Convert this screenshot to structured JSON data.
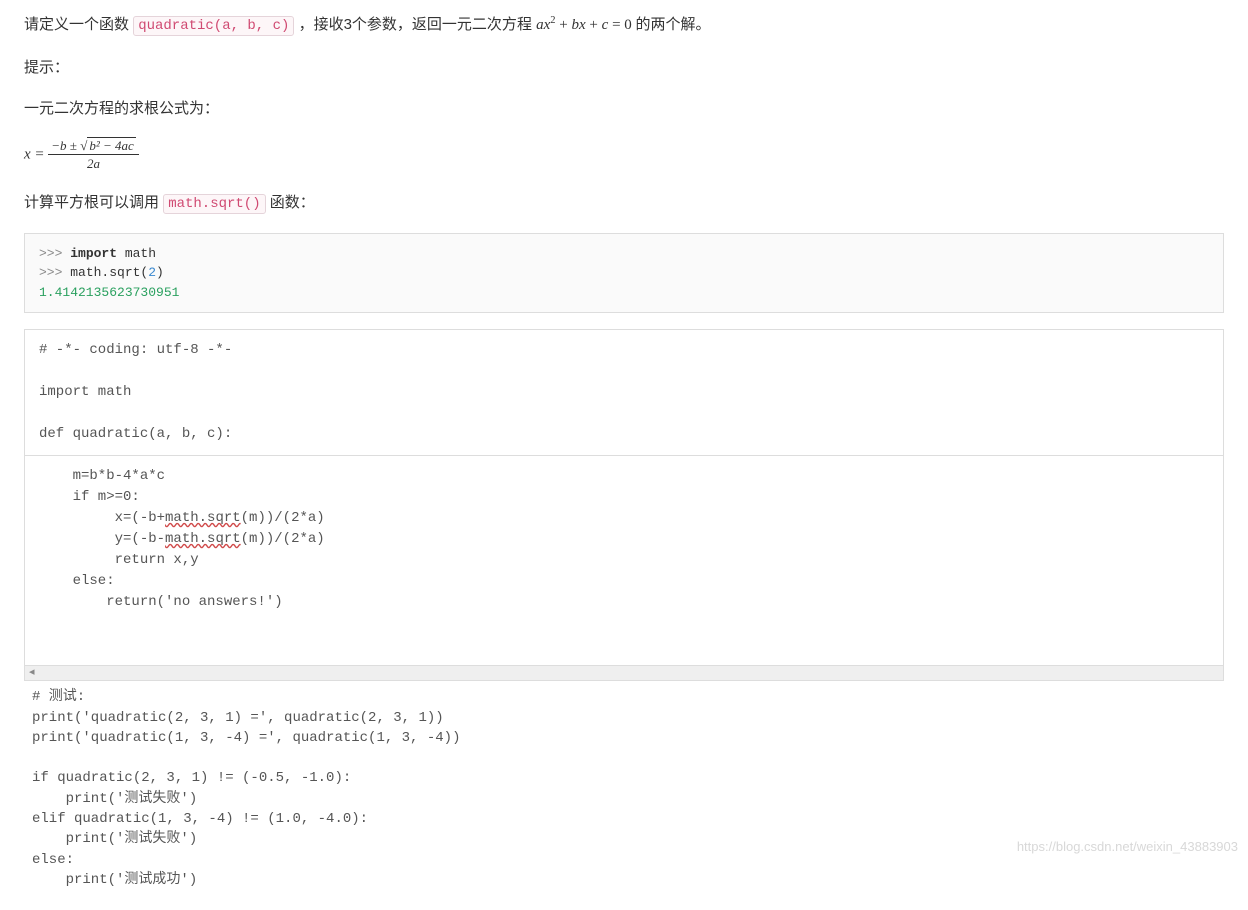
{
  "intro": {
    "prefix": "请定义一个函数",
    "code": "quadratic(a, b, c)",
    "mid": "，接收3个参数，返回一元二次方程 ",
    "equation": {
      "a": "a",
      "x": "x",
      "sq": "2",
      "plus1": " + ",
      "b": "b",
      "plus2": " + ",
      "c": "c",
      "eq": " = ",
      "zero": "0"
    },
    "suffix": " 的两个解。"
  },
  "hint_label": "提示：",
  "formula_label": "一元二次方程的求根公式为：",
  "formula": {
    "lhs": "x = ",
    "num_prefix": "−b ± ",
    "radicand": "b² − 4ac",
    "den": "2a"
  },
  "sqrt_hint": {
    "prefix": "计算平方根可以调用",
    "code": "math.sqrt()",
    "suffix": "函数："
  },
  "repl": {
    "l1p": ">>> ",
    "l1k": "import",
    "l1m": " math",
    "l2p": ">>> ",
    "l2t": "math.sqrt(",
    "l2n": "2",
    "l2e": ")",
    "out": "1.4142135623730951"
  },
  "editor": {
    "top": "# -*- coding: utf-8 -*-\n\nimport math\n\ndef quadratic(a, b, c):",
    "mid_l1": "    m=b*b-4*a*c",
    "mid_l2": "    if m>=0:",
    "mid_l3a": "         x=(-b+",
    "mid_l3b": "math.sqrt",
    "mid_l3c": "(m))/(2*a)",
    "mid_l4a": "         y=(-b-",
    "mid_l4b": "math.sqrt",
    "mid_l4c": "(m))/(2*a)",
    "mid_l5": "         return x,y",
    "mid_l6": "    else:",
    "mid_l7": "        return('no answers!')"
  },
  "tests": "# 测试:\nprint('quadratic(2, 3, 1) =', quadratic(2, 3, 1))\nprint('quadratic(1, 3, -4) =', quadratic(1, 3, -4))\n\nif quadratic(2, 3, 1) != (-0.5, -1.0):\n    print('测试失败')\nelif quadratic(1, 3, -4) != (1.0, -4.0):\n    print('测试失败')\nelse:\n    print('测试成功')",
  "watermark": "https://blog.csdn.net/weixin_43883903"
}
